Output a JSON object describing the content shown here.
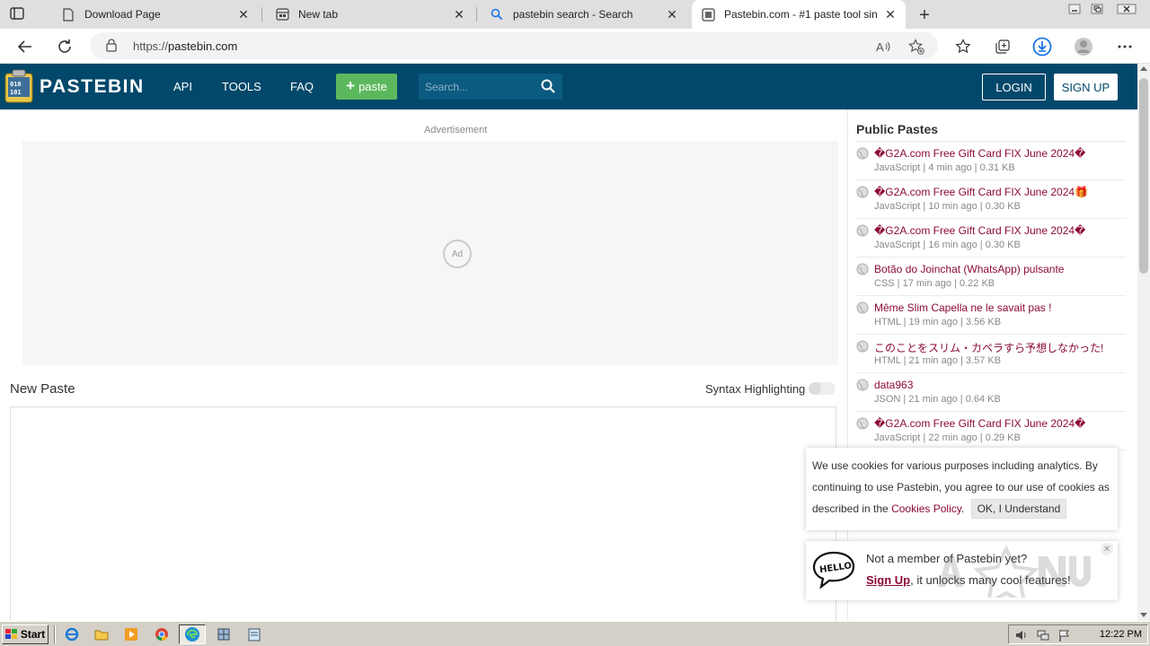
{
  "browser": {
    "tabs": [
      {
        "label": "Download Page",
        "icon": "document-icon"
      },
      {
        "label": "New tab",
        "icon": "newtab-icon"
      },
      {
        "label": "pastebin search - Search",
        "icon": "search-icon"
      },
      {
        "label": "Pastebin.com - #1 paste tool sin",
        "icon": "pastebin-favicon",
        "active": true
      }
    ],
    "url_protocol": "https://",
    "url_host": "pastebin.com"
  },
  "header": {
    "brand": "PASTEBIN",
    "nav": [
      "API",
      "TOOLS",
      "FAQ"
    ],
    "paste_button": "paste",
    "search_placeholder": "Search...",
    "login": "LOGIN",
    "signup": "SIGN UP",
    "header_color": "#02486b",
    "paste_button_color": "#5cb85c"
  },
  "main": {
    "ad_label": "Advertisement",
    "ad_spinner": "Ad",
    "new_paste_title": "New Paste",
    "syntax_label": "Syntax Highlighting"
  },
  "sidebar": {
    "title": "Public Pastes",
    "link_color": "#8d0b35",
    "items": [
      {
        "title": "�G2A.com Free Gift Card FIX June 2024�",
        "meta": "JavaScript | 4 min ago | 0.31 KB"
      },
      {
        "title": "�G2A.com Free Gift Card FIX June 2024🎁",
        "meta": "JavaScript | 10 min ago | 0.30 KB"
      },
      {
        "title": "�G2A.com Free Gift Card FIX June 2024�",
        "meta": "JavaScript | 16 min ago | 0.30 KB"
      },
      {
        "title": "Botão do Joinchat (WhatsApp) pulsante",
        "meta": "CSS | 17 min ago | 0.22 KB"
      },
      {
        "title": "Même Slim Capella ne le savait pas !",
        "meta": "HTML | 19 min ago | 3.56 KB"
      },
      {
        "title": "このことをスリム・カペラすら予想しなかった!",
        "meta": "HTML | 21 min ago | 3.57 KB"
      },
      {
        "title": "data963",
        "meta": "JSON | 21 min ago | 0.64 KB"
      },
      {
        "title": "�G2A.com Free Gift Card FIX June 2024�",
        "meta": "JavaScript | 22 min ago | 0.29 KB"
      }
    ]
  },
  "cookie": {
    "text_before": "We use cookies for various purposes including analytics. By continuing to use Pastebin, you agree to our use of cookies as described in the ",
    "link": "Cookies Policy",
    "text_after": ".",
    "button": "OK, I Understand"
  },
  "member": {
    "line1": "Not a member of Pastebin yet?",
    "signup_link": "Sign Up",
    "line2_rest": ", it unlocks many cool features!"
  },
  "taskbar": {
    "start": "Start",
    "clock": "12:22 PM"
  }
}
